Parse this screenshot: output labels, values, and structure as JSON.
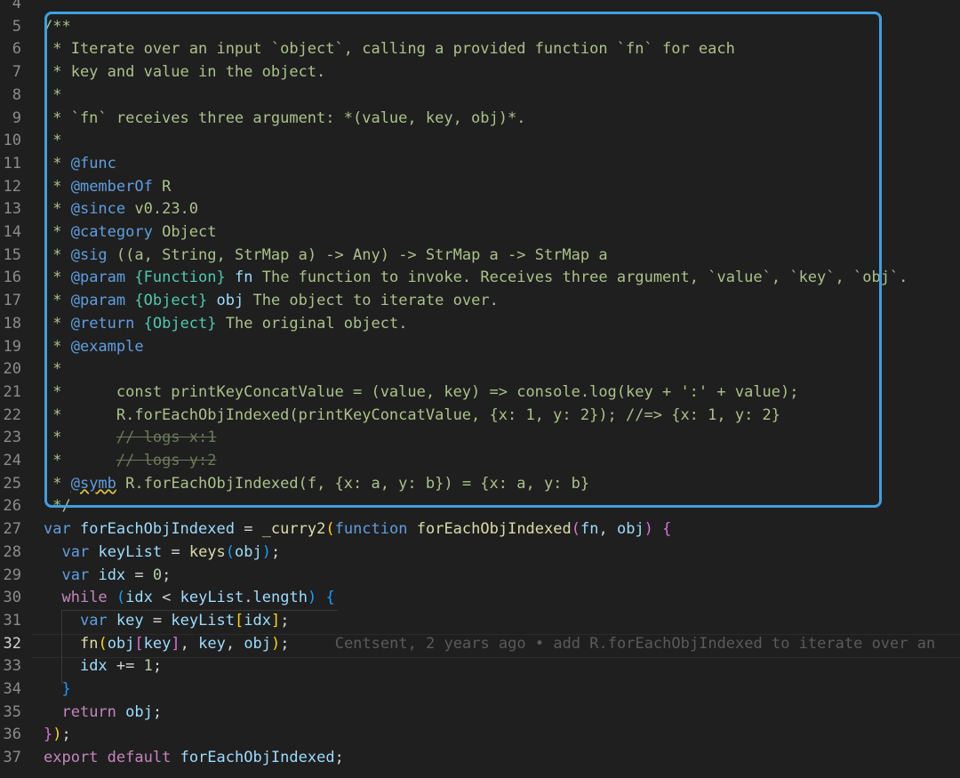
{
  "editor": {
    "lines": [
      {
        "n": "4",
        "tokens": []
      },
      {
        "n": "5",
        "tokens": [
          {
            "c": "t-cm",
            "t": "/**"
          }
        ]
      },
      {
        "n": "6",
        "tokens": [
          {
            "c": "t-cm",
            "t": " * Iterate over an input `object`, calling a provided function `fn` for each"
          }
        ]
      },
      {
        "n": "7",
        "tokens": [
          {
            "c": "t-cm",
            "t": " * key and value in the object."
          }
        ]
      },
      {
        "n": "8",
        "tokens": [
          {
            "c": "t-cm",
            "t": " *"
          }
        ]
      },
      {
        "n": "9",
        "tokens": [
          {
            "c": "t-cm",
            "t": " * `fn` receives three argument: *(value, key, obj)*."
          }
        ]
      },
      {
        "n": "10",
        "tokens": [
          {
            "c": "t-cm",
            "t": " *"
          }
        ]
      },
      {
        "n": "11",
        "tokens": [
          {
            "c": "t-cm",
            "t": " * "
          },
          {
            "c": "t-kw",
            "t": "@func"
          }
        ]
      },
      {
        "n": "12",
        "tokens": [
          {
            "c": "t-cm",
            "t": " * "
          },
          {
            "c": "t-kw",
            "t": "@memberOf"
          },
          {
            "c": "t-cm",
            "t": " R"
          }
        ]
      },
      {
        "n": "13",
        "tokens": [
          {
            "c": "t-cm",
            "t": " * "
          },
          {
            "c": "t-kw",
            "t": "@since"
          },
          {
            "c": "t-cm",
            "t": " v0.23.0"
          }
        ]
      },
      {
        "n": "14",
        "tokens": [
          {
            "c": "t-cm",
            "t": " * "
          },
          {
            "c": "t-kw",
            "t": "@category"
          },
          {
            "c": "t-cm",
            "t": " Object"
          }
        ]
      },
      {
        "n": "15",
        "tokens": [
          {
            "c": "t-cm",
            "t": " * "
          },
          {
            "c": "t-kw",
            "t": "@sig"
          },
          {
            "c": "t-cm",
            "t": " ((a, String, StrMap a) -> Any) -> StrMap a -> StrMap a"
          }
        ]
      },
      {
        "n": "16",
        "tokens": [
          {
            "c": "t-cm",
            "t": " * "
          },
          {
            "c": "t-kw",
            "t": "@param"
          },
          {
            "c": "t-cm",
            "t": " "
          },
          {
            "c": "t-type",
            "t": "{Function}"
          },
          {
            "c": "t-cm",
            "t": " "
          },
          {
            "c": "t-var",
            "t": "fn"
          },
          {
            "c": "t-cm",
            "t": " The function to invoke. Receives three argument, `value`, `key`, `obj`."
          }
        ]
      },
      {
        "n": "17",
        "tokens": [
          {
            "c": "t-cm",
            "t": " * "
          },
          {
            "c": "t-kw",
            "t": "@param"
          },
          {
            "c": "t-cm",
            "t": " "
          },
          {
            "c": "t-type",
            "t": "{Object}"
          },
          {
            "c": "t-cm",
            "t": " "
          },
          {
            "c": "t-var",
            "t": "obj"
          },
          {
            "c": "t-cm",
            "t": " The object to iterate over."
          }
        ]
      },
      {
        "n": "18",
        "tokens": [
          {
            "c": "t-cm",
            "t": " * "
          },
          {
            "c": "t-kw",
            "t": "@return"
          },
          {
            "c": "t-cm",
            "t": " "
          },
          {
            "c": "t-type",
            "t": "{Object}"
          },
          {
            "c": "t-cm",
            "t": " The original object."
          }
        ]
      },
      {
        "n": "19",
        "tokens": [
          {
            "c": "t-cm",
            "t": " * "
          },
          {
            "c": "t-kw",
            "t": "@example"
          }
        ]
      },
      {
        "n": "20",
        "tokens": [
          {
            "c": "t-cm",
            "t": " *"
          }
        ]
      },
      {
        "n": "21",
        "tokens": [
          {
            "c": "t-cm",
            "t": " *      const printKeyConcatValue = (value, key) => console.log(key + ':' + value);"
          }
        ]
      },
      {
        "n": "22",
        "tokens": [
          {
            "c": "t-cm",
            "t": " *      R.forEachObjIndexed(printKeyConcatValue, {x: 1, y: 2}); //=> {x: 1, y: 2}"
          }
        ]
      },
      {
        "n": "23",
        "tokens": [
          {
            "c": "t-cm",
            "t": " *      "
          },
          {
            "c": "t-strike",
            "t": "// logs x:1"
          }
        ]
      },
      {
        "n": "24",
        "tokens": [
          {
            "c": "t-cm",
            "t": " *      "
          },
          {
            "c": "t-strike",
            "t": "// logs y:2"
          }
        ]
      },
      {
        "n": "25",
        "tokens": [
          {
            "c": "t-cm",
            "t": " * "
          },
          {
            "c": "t-kw t-squig",
            "t": "@symb"
          },
          {
            "c": "t-cm",
            "t": " R.forEachObjIndexed(f, {x: a, y: b}) = {x: a, y: b}"
          }
        ]
      },
      {
        "n": "26",
        "tokens": [
          {
            "c": "t-cm",
            "t": " */"
          }
        ]
      },
      {
        "n": "27",
        "tokens": [
          {
            "c": "t-kw",
            "t": "var"
          },
          {
            "c": "t-plain",
            "t": " "
          },
          {
            "c": "t-var",
            "t": "forEachObjIndexed"
          },
          {
            "c": "t-plain",
            "t": " = "
          },
          {
            "c": "t-fn",
            "t": "_curry2"
          },
          {
            "c": "t-br1",
            "t": "("
          },
          {
            "c": "t-kw",
            "t": "function"
          },
          {
            "c": "t-plain",
            "t": " "
          },
          {
            "c": "t-fn",
            "t": "forEachObjIndexed"
          },
          {
            "c": "t-br2",
            "t": "("
          },
          {
            "c": "t-var",
            "t": "fn"
          },
          {
            "c": "t-plain",
            "t": ", "
          },
          {
            "c": "t-var",
            "t": "obj"
          },
          {
            "c": "t-br2",
            "t": ")"
          },
          {
            "c": "t-plain",
            "t": " "
          },
          {
            "c": "t-br2",
            "t": "{"
          }
        ]
      },
      {
        "n": "28",
        "tokens": [
          {
            "c": "t-plain",
            "t": "  "
          },
          {
            "c": "t-kw",
            "t": "var"
          },
          {
            "c": "t-plain",
            "t": " "
          },
          {
            "c": "t-var",
            "t": "keyList"
          },
          {
            "c": "t-plain",
            "t": " = "
          },
          {
            "c": "t-fn",
            "t": "keys"
          },
          {
            "c": "t-br3",
            "t": "("
          },
          {
            "c": "t-var",
            "t": "obj"
          },
          {
            "c": "t-br3",
            "t": ")"
          },
          {
            "c": "t-plain",
            "t": ";"
          }
        ]
      },
      {
        "n": "29",
        "tokens": [
          {
            "c": "t-plain",
            "t": "  "
          },
          {
            "c": "t-kw",
            "t": "var"
          },
          {
            "c": "t-plain",
            "t": " "
          },
          {
            "c": "t-var",
            "t": "idx"
          },
          {
            "c": "t-plain",
            "t": " = "
          },
          {
            "c": "t-num",
            "t": "0"
          },
          {
            "c": "t-plain",
            "t": ";"
          }
        ]
      },
      {
        "n": "30",
        "tokens": [
          {
            "c": "t-plain",
            "t": "  "
          },
          {
            "c": "t-ctl",
            "t": "while"
          },
          {
            "c": "t-plain",
            "t": " "
          },
          {
            "c": "t-br3",
            "t": "("
          },
          {
            "c": "t-var",
            "t": "idx"
          },
          {
            "c": "t-plain",
            "t": " < "
          },
          {
            "c": "t-var",
            "t": "keyList"
          },
          {
            "c": "t-plain",
            "t": "."
          },
          {
            "c": "t-var",
            "t": "length"
          },
          {
            "c": "t-br3",
            "t": ")"
          },
          {
            "c": "t-plain",
            "t": " "
          },
          {
            "c": "t-br3",
            "t": "{"
          }
        ]
      },
      {
        "n": "31",
        "tokens": [
          {
            "c": "t-plain",
            "t": "    "
          },
          {
            "c": "t-kw",
            "t": "var"
          },
          {
            "c": "t-plain",
            "t": " "
          },
          {
            "c": "t-var",
            "t": "key"
          },
          {
            "c": "t-plain",
            "t": " = "
          },
          {
            "c": "t-var",
            "t": "keyList"
          },
          {
            "c": "t-br1",
            "t": "["
          },
          {
            "c": "t-var",
            "t": "idx"
          },
          {
            "c": "t-br1",
            "t": "]"
          },
          {
            "c": "t-plain",
            "t": ";"
          }
        ]
      },
      {
        "n": "32",
        "active": true,
        "tokens": [
          {
            "c": "t-plain",
            "t": "    "
          },
          {
            "c": "t-fn",
            "t": "fn"
          },
          {
            "c": "t-br1",
            "t": "("
          },
          {
            "c": "t-var",
            "t": "obj"
          },
          {
            "c": "t-br2",
            "t": "["
          },
          {
            "c": "t-var",
            "t": "key"
          },
          {
            "c": "t-br2",
            "t": "]"
          },
          {
            "c": "t-plain",
            "t": ", "
          },
          {
            "c": "t-var",
            "t": "key"
          },
          {
            "c": "t-plain",
            "t": ", "
          },
          {
            "c": "t-var",
            "t": "obj"
          },
          {
            "c": "t-br1",
            "t": ")"
          },
          {
            "c": "t-plain",
            "t": ";"
          },
          {
            "c": "t-blame",
            "t": "     Centsent, 2 years ago • add R.forEachObjIndexed to iterate over an"
          }
        ]
      },
      {
        "n": "33",
        "tokens": [
          {
            "c": "t-plain",
            "t": "    "
          },
          {
            "c": "t-var",
            "t": "idx"
          },
          {
            "c": "t-plain",
            "t": " += "
          },
          {
            "c": "t-num",
            "t": "1"
          },
          {
            "c": "t-plain",
            "t": ";"
          }
        ]
      },
      {
        "n": "34",
        "tokens": [
          {
            "c": "t-plain",
            "t": "  "
          },
          {
            "c": "t-br3",
            "t": "}"
          }
        ]
      },
      {
        "n": "35",
        "tokens": [
          {
            "c": "t-plain",
            "t": "  "
          },
          {
            "c": "t-ctl",
            "t": "return"
          },
          {
            "c": "t-plain",
            "t": " "
          },
          {
            "c": "t-var",
            "t": "obj"
          },
          {
            "c": "t-plain",
            "t": ";"
          }
        ]
      },
      {
        "n": "36",
        "tokens": [
          {
            "c": "t-br2",
            "t": "}"
          },
          {
            "c": "t-br1",
            "t": ")"
          },
          {
            "c": "t-plain",
            "t": ";"
          }
        ]
      },
      {
        "n": "37",
        "tokens": [
          {
            "c": "t-ctl",
            "t": "export"
          },
          {
            "c": "t-plain",
            "t": " "
          },
          {
            "c": "t-ctl",
            "t": "default"
          },
          {
            "c": "t-plain",
            "t": " "
          },
          {
            "c": "t-var",
            "t": "forEachObjIndexed"
          },
          {
            "c": "t-plain",
            "t": ";"
          }
        ]
      }
    ]
  },
  "colors": {
    "background": "#1f1f1f",
    "highlight_box": "#3ea0e2",
    "comment": "#a9c28a",
    "jsdoc_tag": "#5f9ee0"
  }
}
